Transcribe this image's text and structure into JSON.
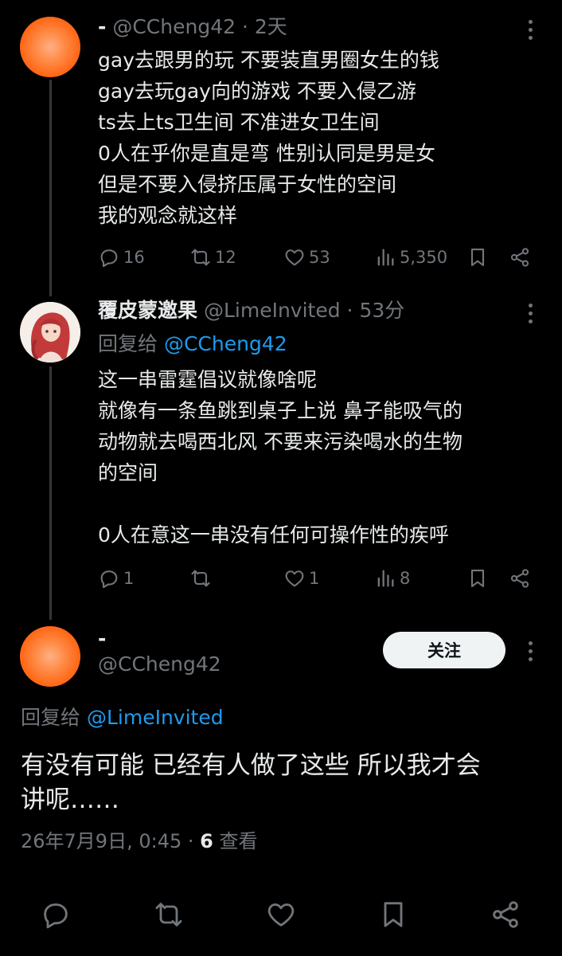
{
  "post1": {
    "name": "-",
    "handle": "@CCheng42",
    "time": "2天",
    "lines": [
      "gay去跟男的玩 不要装直男圈女生的钱",
      "gay去玩gay向的游戏 不要入侵乙游",
      "ts去上ts卫生间 不准进女卫生间",
      "0人在乎你是直是弯 性别认同是男是女",
      "但是不要入侵挤压属于女性的空间",
      "我的观念就这样"
    ],
    "stats": {
      "replies": "16",
      "reposts": "12",
      "likes": "53",
      "views": "5,350"
    }
  },
  "post2": {
    "name": "覆皮蒙邀果",
    "handle": "@LimeInvited",
    "time": "53分",
    "reply_label": "回复给",
    "reply_handle": "@CCheng42",
    "lines": [
      "这一串雷霆倡议就像啥呢",
      "就像有一条鱼跳到桌子上说 鼻子能吸气的",
      "动物就去喝西北风 不要来污染喝水的生物",
      "的空间",
      "",
      "0人在意这一串没有任何可操作性的疾呼"
    ],
    "stats": {
      "replies": "1",
      "likes": "1",
      "views": "8"
    }
  },
  "main": {
    "name": "-",
    "handle": "@CCheng42",
    "follow_label": "关注",
    "reply_label": "回复给",
    "reply_handle": "@LimeInvited",
    "lines": [
      "有没有可能 已经有人做了这些 所以我才会",
      "讲呢……"
    ],
    "date": "26年7月9日, 0:45",
    "dot": "·",
    "views_count": "6",
    "views_label": "查看"
  },
  "colors": {
    "background": "#000000",
    "text": "#e7e9ea",
    "muted": "#71767b",
    "link": "#1d9bf0",
    "avatar_orange": "#ff6a1a"
  },
  "icons": [
    "reply-icon",
    "repost-icon",
    "like-icon",
    "views-icon",
    "bookmark-icon",
    "share-icon",
    "more-icon"
  ]
}
